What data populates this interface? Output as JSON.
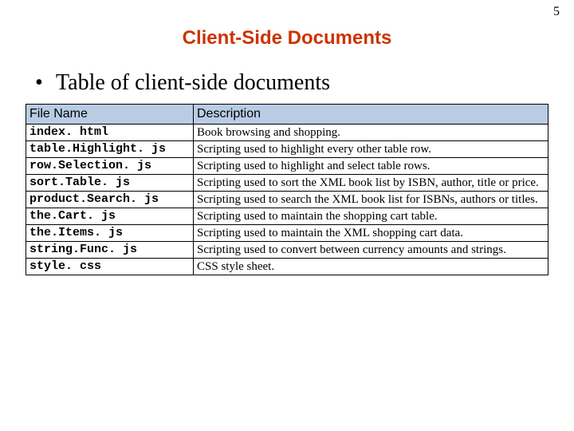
{
  "page_number": "5",
  "title": "Client-Side Documents",
  "bullet": "Table of client-side documents",
  "bullet_glyph": "•",
  "table": {
    "headers": {
      "file": "File Name",
      "desc": "Description"
    },
    "rows": [
      {
        "file": "index. html",
        "desc": "Book browsing and shopping."
      },
      {
        "file": "table.Highlight. js",
        "desc": "Scripting used to highlight every other table row."
      },
      {
        "file": "row.Selection. js",
        "desc": "Scripting used to highlight and select table rows."
      },
      {
        "file": "sort.Table. js",
        "desc": "Scripting used to sort the XML book list by ISBN, author, title or price."
      },
      {
        "file": "product.Search. js",
        "desc": "Scripting used to search the XML book list for ISBNs, authors or titles."
      },
      {
        "file": "the.Cart. js",
        "desc": "Scripting used to maintain the shopping cart table."
      },
      {
        "file": "the.Items. js",
        "desc": "Scripting used to maintain the XML shopping cart data."
      },
      {
        "file": "string.Func. js",
        "desc": "Scripting used to convert between currency amounts and strings."
      },
      {
        "file": "style. css",
        "desc": "CSS style sheet."
      }
    ]
  }
}
